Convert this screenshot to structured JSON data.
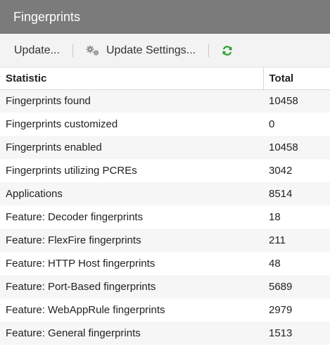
{
  "window": {
    "title": "Fingerprints"
  },
  "toolbar": {
    "update_label": "Update...",
    "update_settings_label": "Update Settings...",
    "icons": {
      "settings": "gears-icon",
      "refresh": "refresh-icon"
    },
    "refresh_color": "#2e9e2e"
  },
  "table": {
    "headers": {
      "statistic": "Statistic",
      "total": "Total"
    },
    "rows": [
      {
        "statistic": "Fingerprints found",
        "total": "10458"
      },
      {
        "statistic": "Fingerprints customized",
        "total": "0"
      },
      {
        "statistic": "Fingerprints enabled",
        "total": "10458"
      },
      {
        "statistic": "Fingerprints utilizing PCREs",
        "total": "3042"
      },
      {
        "statistic": "Applications",
        "total": "8514"
      },
      {
        "statistic": "Feature: Decoder fingerprints",
        "total": "18"
      },
      {
        "statistic": "Feature: FlexFire fingerprints",
        "total": "211"
      },
      {
        "statistic": "Feature: HTTP Host fingerprints",
        "total": "48"
      },
      {
        "statistic": "Feature: Port-Based fingerprints",
        "total": "5689"
      },
      {
        "statistic": "Feature: WebAppRule fingerprints",
        "total": "2979"
      },
      {
        "statistic": "Feature: General fingerprints",
        "total": "1513"
      }
    ]
  }
}
